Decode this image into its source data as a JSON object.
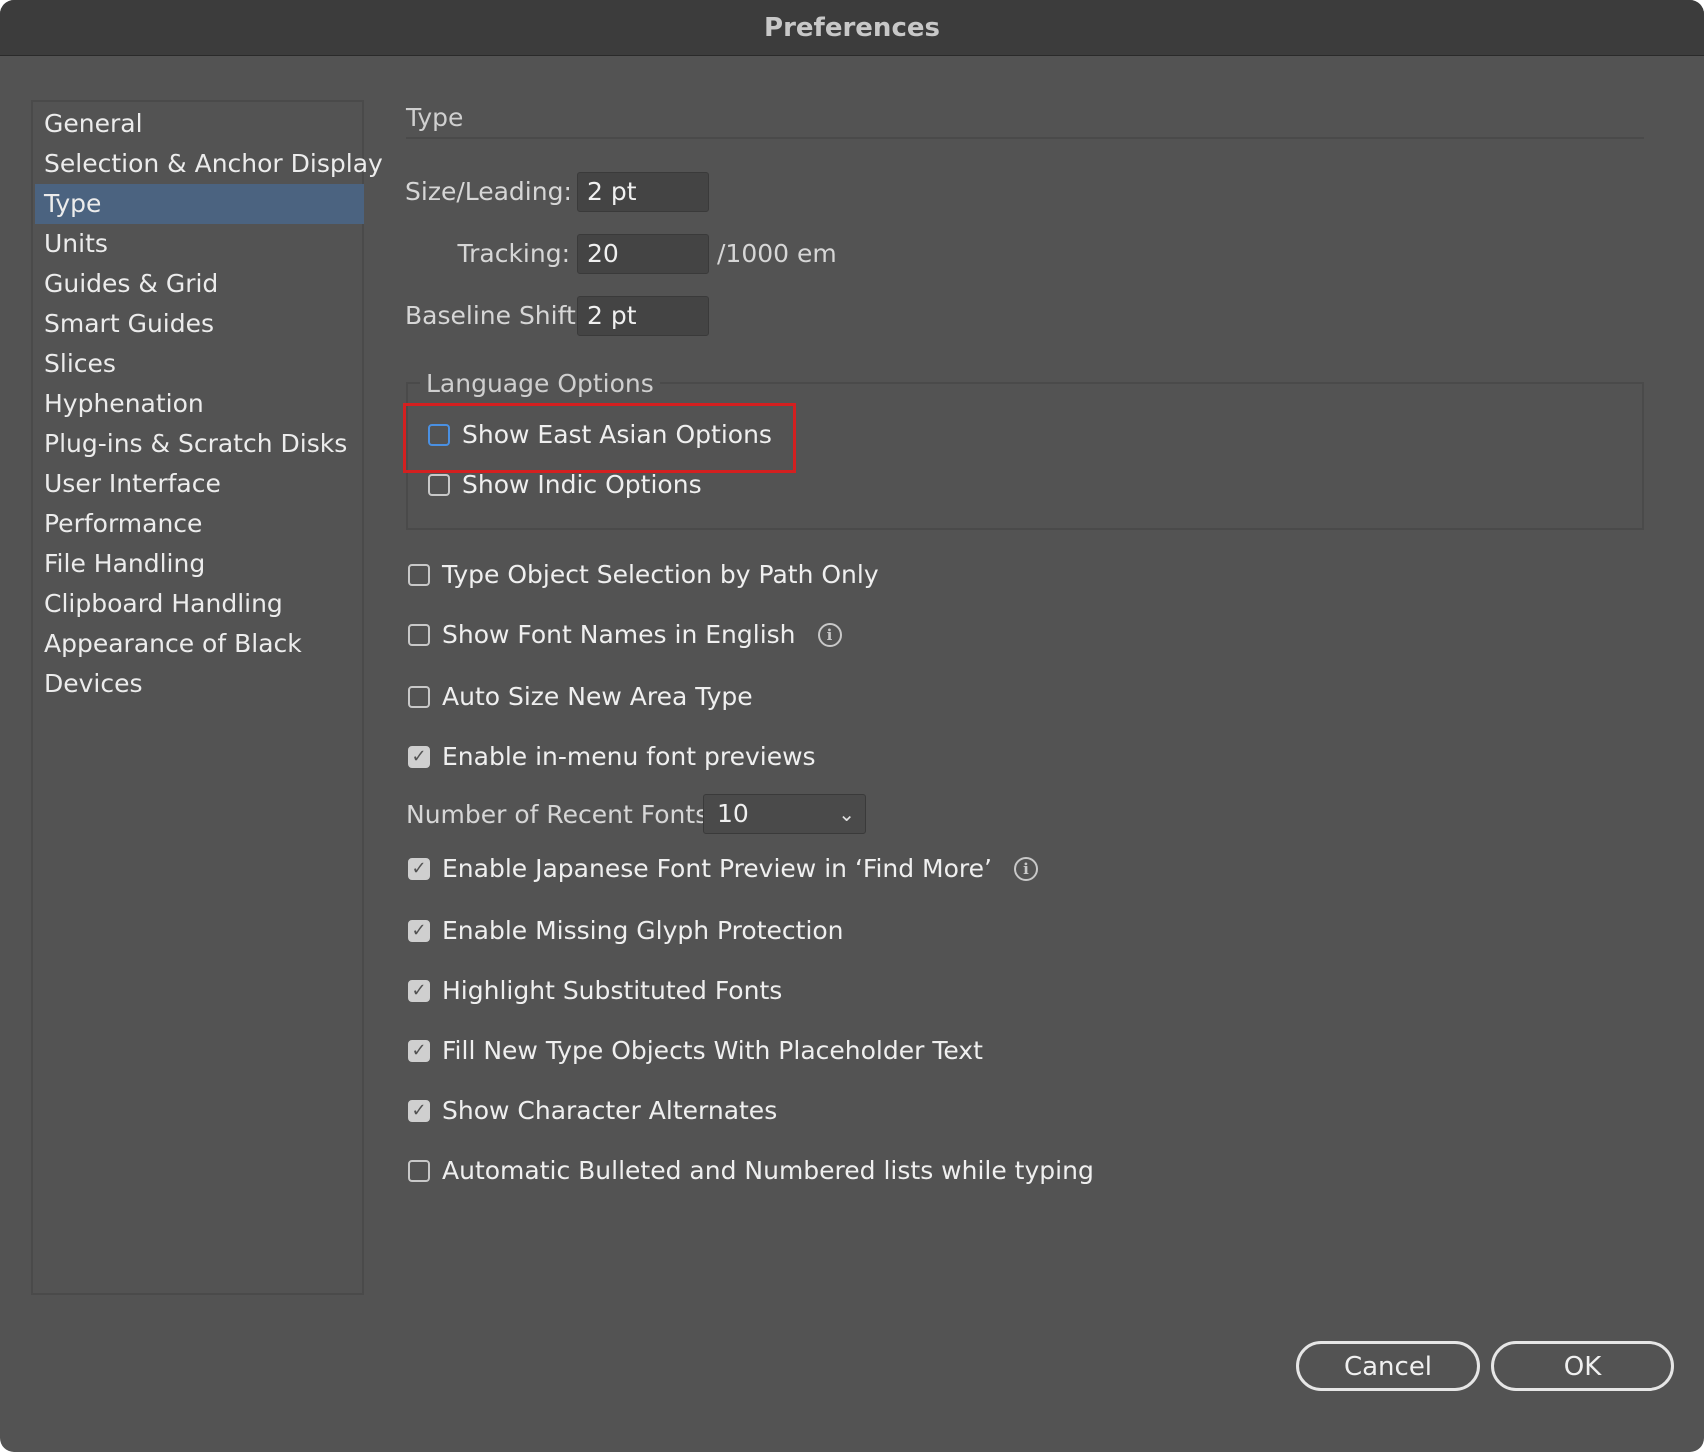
{
  "window": {
    "title": "Preferences"
  },
  "sidebar": {
    "items": [
      {
        "label": "General"
      },
      {
        "label": "Selection & Anchor Display"
      },
      {
        "label": "Type",
        "selected": true
      },
      {
        "label": "Units"
      },
      {
        "label": "Guides & Grid"
      },
      {
        "label": "Smart Guides"
      },
      {
        "label": "Slices"
      },
      {
        "label": "Hyphenation"
      },
      {
        "label": "Plug-ins & Scratch Disks"
      },
      {
        "label": "User Interface"
      },
      {
        "label": "Performance"
      },
      {
        "label": "File Handling"
      },
      {
        "label": "Clipboard Handling"
      },
      {
        "label": "Appearance of Black"
      },
      {
        "label": "Devices"
      }
    ]
  },
  "main": {
    "section_title": "Type",
    "size_leading": {
      "label": "Size/Leading:",
      "value": "2 pt"
    },
    "tracking": {
      "label": "Tracking:",
      "value": "20",
      "unit": "/1000 em"
    },
    "baseline_shift": {
      "label": "Baseline Shift:",
      "value": "2 pt"
    },
    "language_options": {
      "title": "Language Options",
      "show_east_asian": {
        "label": "Show East Asian Options",
        "checked": false
      },
      "show_indic": {
        "label": "Show Indic Options",
        "checked": false
      }
    },
    "options": {
      "type_object_selection": {
        "label": "Type Object Selection by Path Only",
        "checked": false
      },
      "font_names_english": {
        "label": "Show Font Names in English",
        "checked": false
      },
      "auto_size_area_type": {
        "label": "Auto Size New Area Type",
        "checked": false
      },
      "in_menu_previews": {
        "label": "Enable in-menu font previews",
        "checked": true
      },
      "japanese_preview": {
        "label": "Enable Japanese Font Preview in ‘Find More’",
        "checked": true
      },
      "missing_glyph": {
        "label": "Enable Missing Glyph Protection",
        "checked": true
      },
      "highlight_substituted": {
        "label": "Highlight Substituted Fonts",
        "checked": true
      },
      "placeholder_text": {
        "label": "Fill New Type Objects With Placeholder Text",
        "checked": true
      },
      "character_alternates": {
        "label": "Show Character Alternates",
        "checked": true
      },
      "auto_lists": {
        "label": "Automatic Bulleted and Numbered lists while typing",
        "checked": false
      }
    },
    "recent_fonts": {
      "label": "Number of Recent Fonts:",
      "value": "10"
    }
  },
  "footer": {
    "cancel_label": "Cancel",
    "ok_label": "OK"
  },
  "icons": {
    "check": "checkmark-icon",
    "info": "info-icon",
    "dropdown": "chevron-down-icon"
  },
  "colors": {
    "background": "#535353",
    "selection": "#4b6380",
    "highlight": "#d42020"
  }
}
